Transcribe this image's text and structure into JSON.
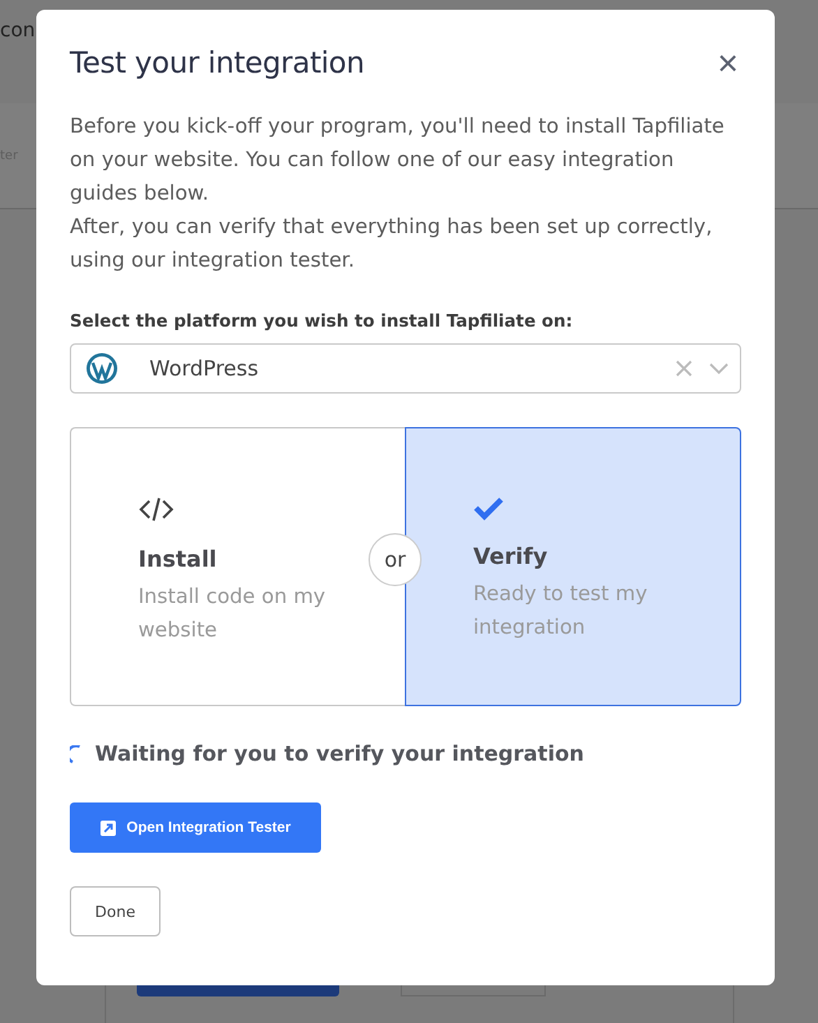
{
  "background_page": {
    "texts": [
      "con",
      "ter"
    ]
  },
  "dialog": {
    "title": "Test your integration",
    "close": "×",
    "intro": [
      "Before you kick-off your program, you'll need to install Tapfiliate on your website. You can follow one of our easy integration guides below.",
      "After, you can verify that everything has been set up correctly, using our integration tester."
    ],
    "platform_label": "Select the platform you wish to install Tapfiliate on:",
    "platform_select": {
      "value": "WordPress"
    },
    "options": [
      {
        "title": "Install",
        "description": "Install code on my website",
        "selected": false
      },
      {
        "title": "Verify",
        "description": "Ready to test my integration",
        "selected": true
      }
    ],
    "separator": "or",
    "status": "Waiting for you to verify your integration",
    "primary_button": "Open Integration Tester",
    "secondary_button": "Done"
  }
}
